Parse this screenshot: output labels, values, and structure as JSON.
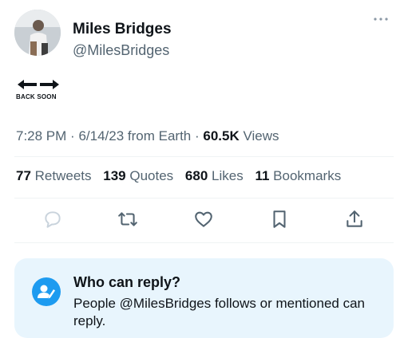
{
  "user": {
    "name": "Miles Bridges",
    "handle": "@MilesBridges"
  },
  "tweet": {
    "image_text": "BACK SOON",
    "time": "7:28 PM",
    "date": "6/14/23",
    "source": "from Earth",
    "views_count": "60.5K",
    "views_label": "Views"
  },
  "stats": [
    {
      "count": "77",
      "label": "Retweets"
    },
    {
      "count": "139",
      "label": "Quotes"
    },
    {
      "count": "680",
      "label": "Likes"
    },
    {
      "count": "11",
      "label": "Bookmarks"
    }
  ],
  "actions": [
    "reply-icon",
    "retweet-icon",
    "like-icon",
    "bookmark-icon",
    "share-icon"
  ],
  "reply_restriction": {
    "title": "Who can reply?",
    "text": "People @MilesBridges follows or mentioned can reply."
  },
  "colors": {
    "accent": "#1d9bf0",
    "secondary_text": "#536471",
    "notice_bg": "#e8f5fd"
  }
}
